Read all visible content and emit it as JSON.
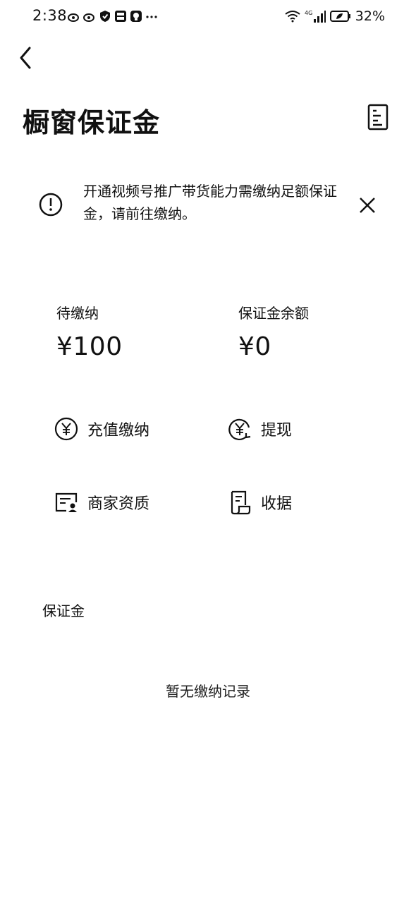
{
  "status_bar": {
    "time": "2:38",
    "network_label": "4G",
    "battery": "32%",
    "notification_icons": [
      "weibo-icon",
      "weibo-icon",
      "shield-icon",
      "app-icon",
      "app-icon",
      "more-dots"
    ]
  },
  "header": {
    "title": "橱窗保证金"
  },
  "notice": {
    "text": "开通视频号推广带货能力需缴纳足额保证金，请前往缴纳。"
  },
  "balances": {
    "pending_label": "待缴纳",
    "pending_value": "¥100",
    "balance_label": "保证金余额",
    "balance_value": "¥0"
  },
  "actions": {
    "recharge": "充值缴纳",
    "withdraw": "提现",
    "merchant": "商家资质",
    "receipt": "收据"
  },
  "section": {
    "title": "保证金",
    "empty_text": "暂无缴纳记录"
  }
}
